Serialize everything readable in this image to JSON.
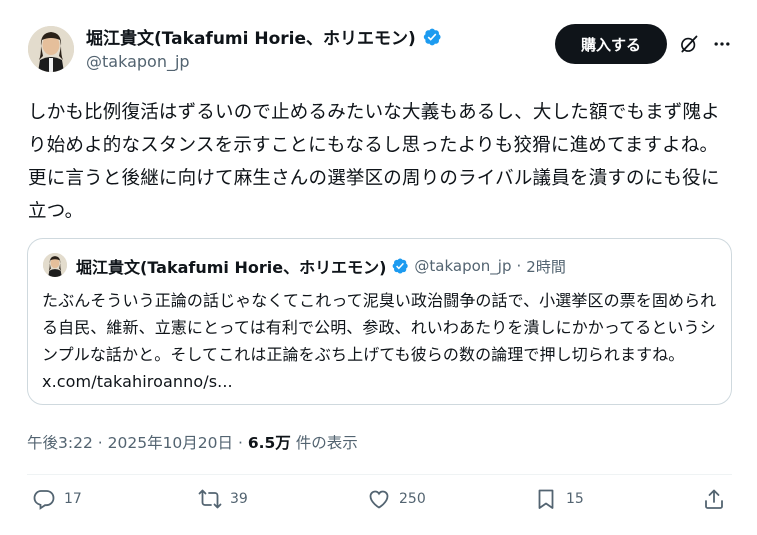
{
  "author": {
    "name": "堀江貴文(Takafumi Horie、ホリエモン)",
    "handle": "@takapon_jp",
    "verified_color": "#1d9bf0"
  },
  "header": {
    "buy_label": "購入する",
    "grok_icon": "grok-icon",
    "more_icon": "more-icon"
  },
  "tweet": {
    "text": "しかも比例復活はずるいので止めるみたいな大義もあるし、大した額でもまず隗より始めよ的なスタンスを示すことにもなるし思ったよりも狡猾に進めてますよね。更に言うと後継に向けて麻生さんの選挙区の周りのライバル議員を潰すのにも役に立つ。"
  },
  "quote": {
    "name": "堀江貴文(Takafumi Horie、ホリエモン)",
    "handle": "@takapon_jp",
    "separator": "·",
    "time": "2時間",
    "text": "たぶんそういう正論の話じゃなくてこれって泥臭い政治闘争の話で、小選挙区の票を固められる自民、維新、立憲にとっては有利で公明、参政、れいわあたりを潰しにかかってるというシンプルな話かと。そしてこれは正論をぶち上げても彼らの数の論理で押し切られますね。",
    "link": "x.com/takahiroanno/s..."
  },
  "meta": {
    "time": "午後3:22",
    "separator1": "·",
    "date": "2025年10月20日",
    "separator2": "·",
    "views": "6.5万",
    "views_label": "件の表示"
  },
  "actions": {
    "reply_count": "17",
    "retweet_count": "39",
    "like_count": "250",
    "bookmark_count": "15"
  }
}
